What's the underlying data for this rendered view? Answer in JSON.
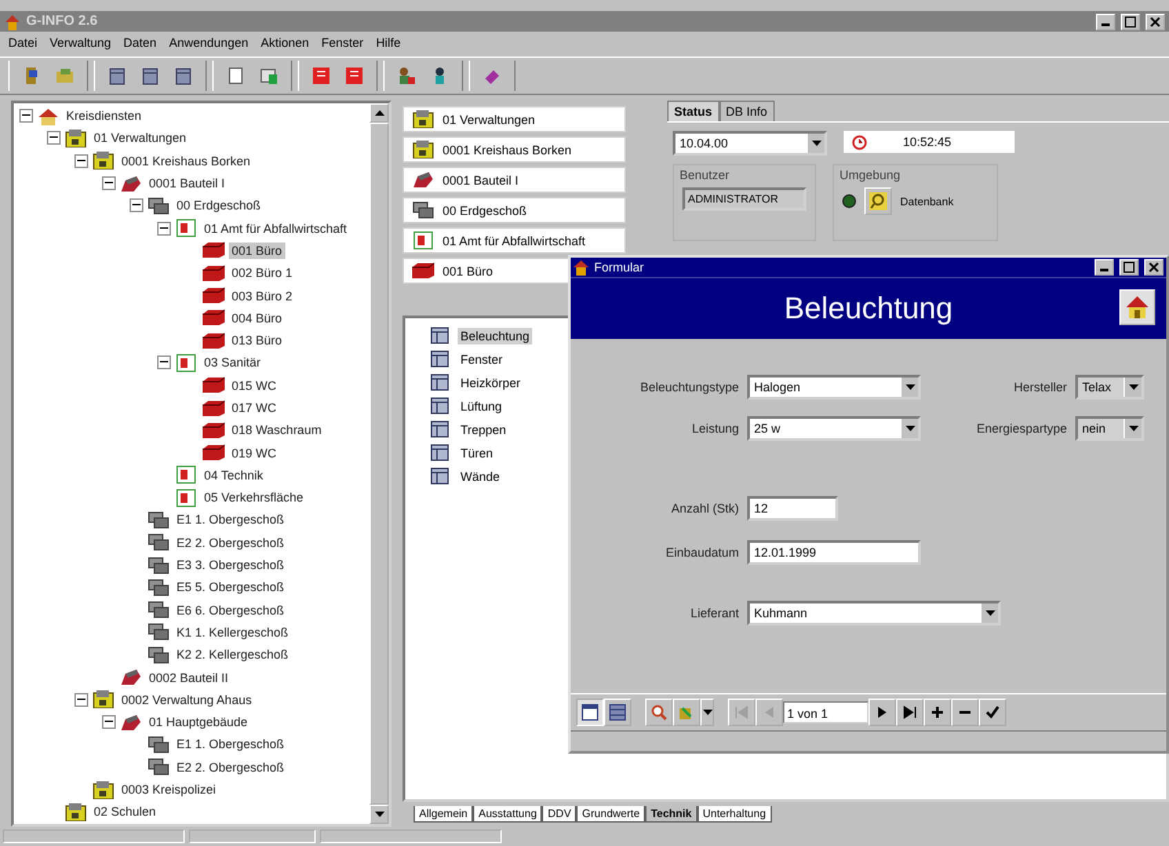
{
  "window": {
    "title": "G-INFO 2.6"
  },
  "menu": [
    "Datei",
    "Verwaltung",
    "Daten",
    "Anwendungen",
    "Aktionen",
    "Fenster",
    "Hilfe"
  ],
  "tree": [
    {
      "label": "Kreisdiensten",
      "kind": "house",
      "selected": false,
      "expanded": true,
      "children": [
        {
          "label": "01 Verwaltungen",
          "kind": "building",
          "selected": false,
          "expanded": true,
          "children": [
            {
              "label": "0001 Kreishaus Borken",
              "kind": "building",
              "selected": false,
              "expanded": true,
              "children": [
                {
                  "label": "0001 Bauteil I",
                  "kind": "wing",
                  "selected": false,
                  "expanded": true,
                  "children": [
                    {
                      "label": "00 Erdgeschoß",
                      "kind": "floor",
                      "selected": false,
                      "expanded": true,
                      "children": [
                        {
                          "label": "01 Amt für Abfallwirtschaft",
                          "kind": "dept",
                          "selected": false,
                          "expanded": true,
                          "children": [
                            {
                              "label": "001 Büro",
                              "kind": "room",
                              "selected": true
                            },
                            {
                              "label": "002 Büro 1",
                              "kind": "room",
                              "selected": false
                            },
                            {
                              "label": "003 Büro 2",
                              "kind": "room",
                              "selected": false
                            },
                            {
                              "label": "004 Büro",
                              "kind": "room",
                              "selected": false
                            },
                            {
                              "label": "013 Büro",
                              "kind": "room",
                              "selected": false
                            }
                          ]
                        },
                        {
                          "label": "03 Sanitär",
                          "kind": "dept",
                          "selected": false,
                          "expanded": true,
                          "children": [
                            {
                              "label": "015 WC",
                              "kind": "room",
                              "selected": false
                            },
                            {
                              "label": "017 WC",
                              "kind": "room",
                              "selected": false
                            },
                            {
                              "label": "018 Waschraum",
                              "kind": "room",
                              "selected": false
                            },
                            {
                              "label": "019 WC",
                              "kind": "room",
                              "selected": false
                            }
                          ]
                        },
                        {
                          "label": "04 Technik",
                          "kind": "dept",
                          "selected": false
                        },
                        {
                          "label": "05 Verkehrsfläche",
                          "kind": "dept",
                          "selected": false
                        }
                      ]
                    },
                    {
                      "label": "E1 1. Obergeschoß",
                      "kind": "floor",
                      "selected": false
                    },
                    {
                      "label": "E2 2. Obergeschoß",
                      "kind": "floor",
                      "selected": false
                    },
                    {
                      "label": "E3 3. Obergeschoß",
                      "kind": "floor",
                      "selected": false
                    },
                    {
                      "label": "E5 5. Obergeschoß",
                      "kind": "floor",
                      "selected": false
                    },
                    {
                      "label": "E6 6. Obergeschoß",
                      "kind": "floor",
                      "selected": false
                    },
                    {
                      "label": "K1 1. Kellergeschoß",
                      "kind": "floor",
                      "selected": false
                    },
                    {
                      "label": "K2 2. Kellergeschoß",
                      "kind": "floor",
                      "selected": false
                    }
                  ]
                },
                {
                  "label": "0002 Bauteil II",
                  "kind": "wing",
                  "selected": false
                }
              ]
            },
            {
              "label": "0002 Verwaltung Ahaus",
              "kind": "building",
              "selected": false,
              "expanded": true,
              "children": [
                {
                  "label": "01 Hauptgebäude",
                  "kind": "wing",
                  "selected": false,
                  "expanded": true,
                  "children": [
                    {
                      "label": "E1 1. Obergeschoß",
                      "kind": "floor",
                      "selected": false
                    },
                    {
                      "label": "E2 2. Obergeschoß",
                      "kind": "floor",
                      "selected": false
                    }
                  ]
                }
              ]
            },
            {
              "label": "0003 Kreispolizei",
              "kind": "building",
              "selected": false
            }
          ]
        },
        {
          "label": "02 Schulen",
          "kind": "building",
          "selected": false
        }
      ]
    }
  ],
  "breadcrumbs": [
    {
      "label": "01 Verwaltungen",
      "kind": "building"
    },
    {
      "label": "0001 Kreishaus Borken",
      "kind": "building"
    },
    {
      "label": "0001 Bauteil I",
      "kind": "wing"
    },
    {
      "label": "00 Erdgeschoß",
      "kind": "floor"
    },
    {
      "label": "01 Amt für Abfallwirtschaft",
      "kind": "dept"
    },
    {
      "label": "001 Büro",
      "kind": "room"
    }
  ],
  "status_panel": {
    "tabs": [
      {
        "label": "Status",
        "selected": true
      },
      {
        "label": "DB Info",
        "selected": false
      }
    ],
    "date": "10.04.00",
    "time": "10:52:45",
    "user_group": {
      "title": "Benutzer",
      "value": "ADMINISTRATOR"
    },
    "env_group": {
      "title": "Umgebung",
      "connected": true,
      "label": "Datenbank"
    }
  },
  "objects": [
    {
      "label": "Beleuchtung",
      "selected": true
    },
    {
      "label": "Fenster",
      "selected": false
    },
    {
      "label": "Heizkörper",
      "selected": false
    },
    {
      "label": "Lüftung",
      "selected": false
    },
    {
      "label": "Treppen",
      "selected": false
    },
    {
      "label": "Türen",
      "selected": false
    },
    {
      "label": "Wände",
      "selected": false
    }
  ],
  "bottom_tabs": [
    {
      "label": "Allgemein",
      "selected": false
    },
    {
      "label": "Ausstattung",
      "selected": false
    },
    {
      "label": "DDV",
      "selected": false
    },
    {
      "label": "Grundwerte",
      "selected": false
    },
    {
      "label": "Technik",
      "selected": true
    },
    {
      "label": "Unterhaltung",
      "selected": false
    }
  ],
  "form": {
    "title": "Formular",
    "heading": "Beleuchtung",
    "left_fields": [
      {
        "label": "Beleuchtungstype",
        "value": "Halogen",
        "kind": "combo"
      },
      {
        "label": "Leistung",
        "value": "25 w",
        "kind": "combo"
      }
    ],
    "right_fields": [
      {
        "label": "Hersteller",
        "value": "Telax",
        "kind": "combo"
      },
      {
        "label": "Energiespartype",
        "value": "nein",
        "kind": "combo"
      }
    ],
    "lower_fields": [
      {
        "label": "Anzahl (Stk)",
        "value": "12",
        "kind": "text"
      },
      {
        "label": "Einbaudatum",
        "value": "12.01.1999",
        "kind": "text"
      },
      {
        "label": "Lieferant",
        "value": "Kuhmann",
        "kind": "combo"
      }
    ],
    "record": "1 von 1"
  }
}
